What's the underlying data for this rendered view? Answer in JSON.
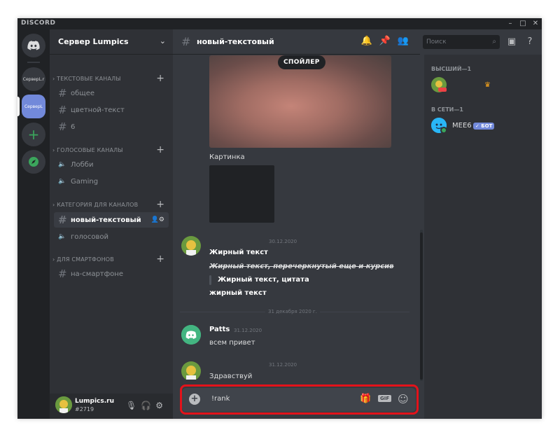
{
  "app": {
    "title": "DISCORD",
    "window_controls": [
      "–",
      "□",
      "✕"
    ]
  },
  "servers": [
    {
      "label": "",
      "icon": "discord-home-icon"
    },
    {
      "label": "СерверL.r"
    },
    {
      "label": "СерверL"
    },
    {
      "label": "+",
      "icon": "add-server-icon"
    },
    {
      "label": "",
      "icon": "explore-icon"
    }
  ],
  "sidebar": {
    "server_name": "Сервер Lumpics",
    "categories": [
      {
        "name": "ТЕКСТОВЫЕ КАНАЛЫ",
        "channels": [
          "общее",
          "цветной-текст",
          "6"
        ]
      },
      {
        "name": "ГОЛОСОВЫЕ КАНАЛЫ",
        "channels": [
          "Лобби",
          "Gaming"
        ]
      },
      {
        "name": "КАТЕГОРИЯ ДЛЯ КАНАЛОВ",
        "channels": [
          "новый-текстовый",
          "голосовой"
        ]
      },
      {
        "name": "ДЛЯ СМАРТФОНОВ",
        "channels": [
          "на-смартфоне"
        ]
      }
    ]
  },
  "user": {
    "name": "Lumpics.ru",
    "tag": "#2719"
  },
  "header": {
    "channel": "новый-текстовый"
  },
  "search": {
    "placeholder": "Поиск"
  },
  "members": {
    "groups": [
      {
        "name": "ВЫСШИЙ—1"
      },
      {
        "name": "В СЕТИ—1"
      }
    ],
    "bot_name": "MEE6",
    "bot_badge": "✓ БОТ"
  },
  "chat": {
    "spoiler_label": "СПОЙЛЕР",
    "image_caption": "Картинка",
    "group1": {
      "timestamp": "30.12.2020",
      "lines": [
        "Жирный текст",
        "Жирный текст, перечеркнутый еще и курсив",
        "Жирный текст, цитата",
        "жирный текст"
      ]
    },
    "date_divider": "31 декабря 2020 г.",
    "msg_patts": {
      "author": "Patts",
      "timestamp": "31.12.2020",
      "text": "всем привет"
    },
    "msg_reply": {
      "timestamp": "31.12.2020",
      "text": "Здравствуй"
    }
  },
  "composer": {
    "value": "!rank",
    "gif_label": "GIF"
  },
  "colors": {
    "accent": "#7289da",
    "highlight": "#e3131b",
    "online": "#3ba55c"
  }
}
